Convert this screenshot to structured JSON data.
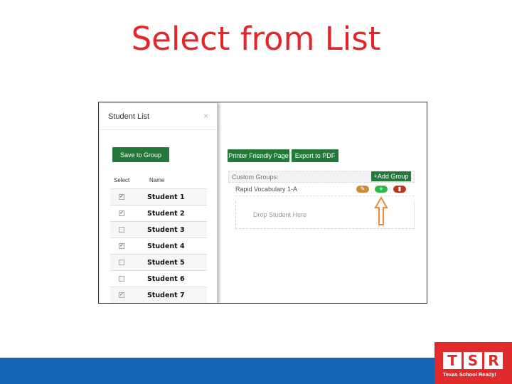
{
  "slide": {
    "title": "Select from List"
  },
  "modal": {
    "title": "Student List",
    "close": "×",
    "save_button": "Save to Group",
    "col_select": "Select",
    "col_name": "Name",
    "students": [
      {
        "name": "Student 1",
        "checked": true
      },
      {
        "name": "Student 2",
        "checked": true
      },
      {
        "name": "Student 3",
        "checked": false
      },
      {
        "name": "Student 4",
        "checked": true
      },
      {
        "name": "Student 5",
        "checked": false
      },
      {
        "name": "Student 6",
        "checked": false
      },
      {
        "name": "Student 7",
        "checked": true
      }
    ]
  },
  "main": {
    "printer_button": "Printer Friendly Page",
    "pdf_button": "Export to PDF",
    "custom_groups_label": "Custom Groups:",
    "add_group_button": "+Add Group",
    "group_name": "Rapid Vocabulary 1-A",
    "drop_text": "Drop Student Here",
    "icons": {
      "edit": "pencil-icon",
      "add": "plus-icon",
      "delete": "trash-icon"
    }
  },
  "colors": {
    "title": "#e3262a",
    "green": "#23783a",
    "edit": "#d08a35",
    "add": "#2fb84a",
    "delete": "#c0341d",
    "arrow": "#ef8a3b",
    "bar": "#1565b5",
    "logo": "#e02a2b"
  },
  "logo": {
    "letters": "TSR",
    "tagline": "Texas School Ready!"
  }
}
